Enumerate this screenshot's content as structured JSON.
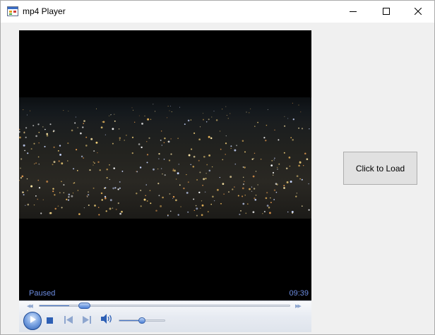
{
  "window": {
    "title": "mp4 Player",
    "icon": "app-window-icon",
    "controls": [
      "minimize-icon",
      "maximize-icon",
      "close-icon"
    ]
  },
  "player": {
    "status": "Paused",
    "time": "09:39",
    "progress_fraction": 0.12,
    "volume_fraction": 0.5,
    "controls": [
      "play-icon",
      "stop-icon",
      "previous-icon",
      "next-icon",
      "volume-icon"
    ],
    "accent_color": "#4a78c9",
    "status_color": "#6c8ce0"
  },
  "load_button": {
    "label": "Click to Load"
  }
}
